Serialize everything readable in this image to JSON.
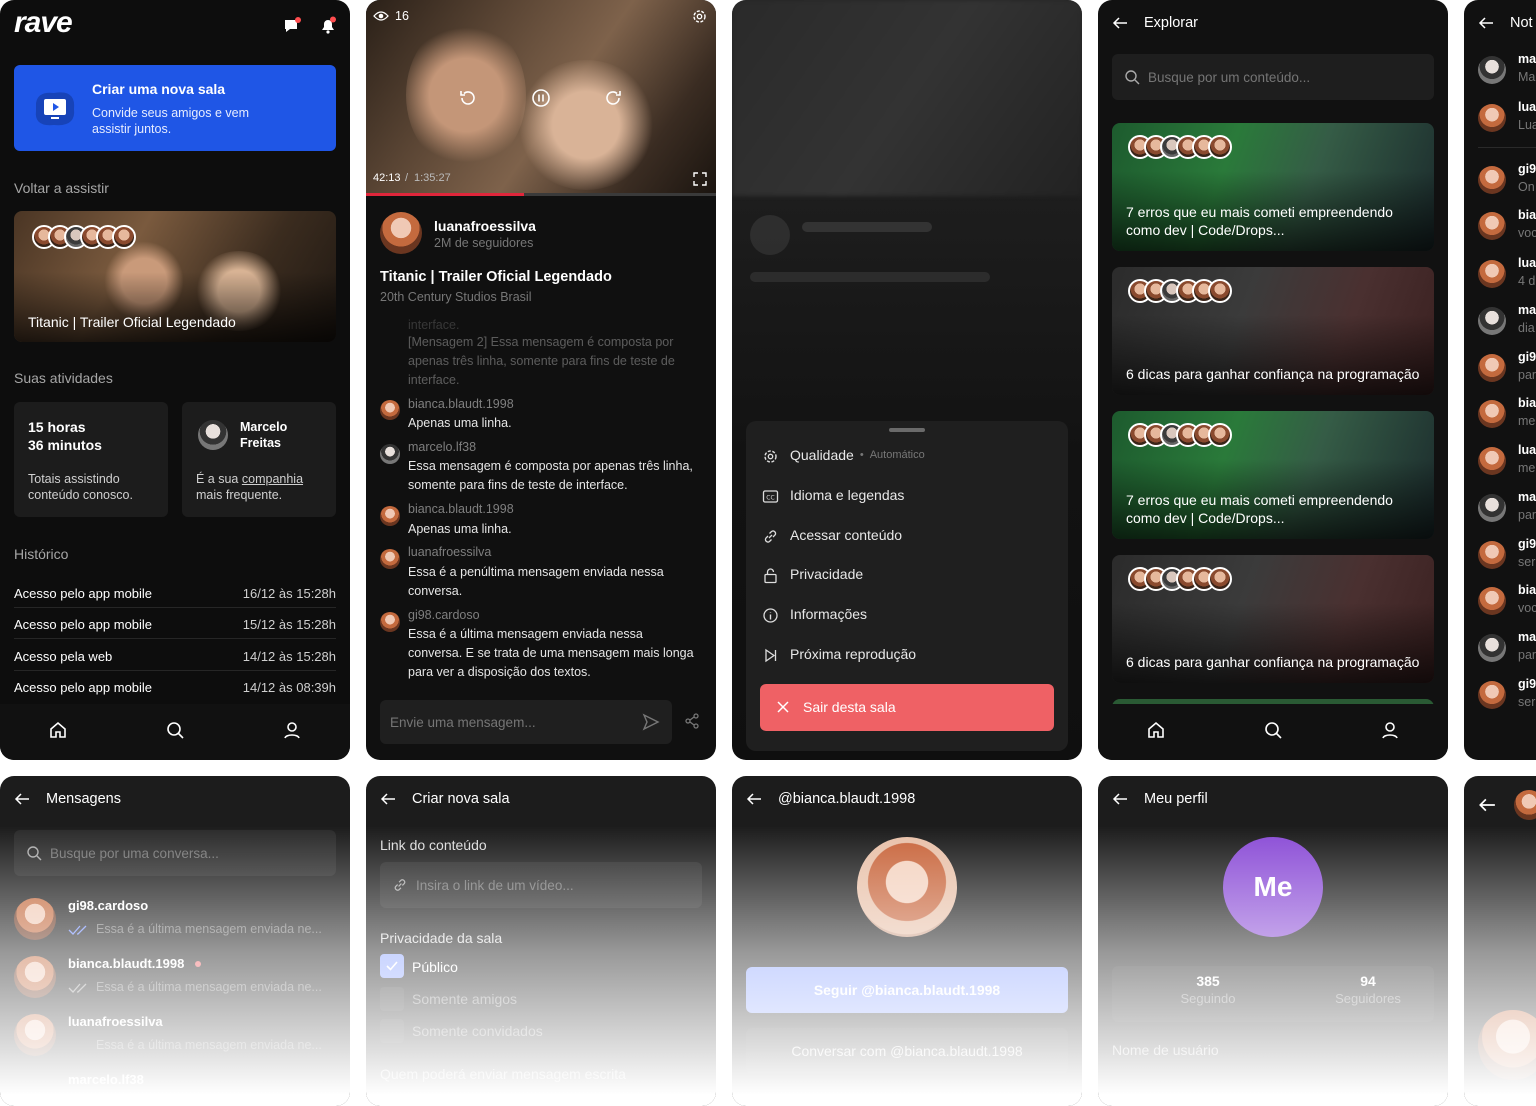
{
  "home": {
    "logo": "rave",
    "create_title": "Criar uma nova sala",
    "create_sub": "Convide seus amigos e vem assistir juntos.",
    "continue_label": "Voltar a assistir",
    "continue_video": "Titanic | Trailer Oficial Legendado",
    "activities_label": "Suas atividades",
    "hours": "15 horas\n36 minutos",
    "hours_desc": "Totais assistindo conteúdo conosco.",
    "friend_name": "Marcelo\nFreitas",
    "friend_desc_a": "É a sua ",
    "friend_desc_link": "companhia",
    "friend_desc_b": "mais frequente.",
    "history_label": "Histórico",
    "history": [
      {
        "label": "Acesso pelo app mobile",
        "date": "16/12 às 15:28h"
      },
      {
        "label": "Acesso pelo app mobile",
        "date": "15/12 às 15:28h"
      },
      {
        "label": "Acesso pela web",
        "date": "14/12 às 15:28h"
      },
      {
        "label": "Acesso pelo app mobile",
        "date": "14/12 às 08:39h"
      }
    ]
  },
  "player": {
    "views": "16",
    "time": "42:13",
    "duration": "1:35:27",
    "progress": 0.45,
    "channel": "luanafroessilva",
    "followers": "2M de seguidores",
    "title": "Titanic | Trailer Oficial Legendado",
    "studio": "20th Century Studios Brasil",
    "messages": [
      {
        "user": "interface.",
        "text": "[Mensagem 2] Essa mensagem é composta por apenas três linha, somente para fins de teste de interface.",
        "faded": true
      },
      {
        "user": "bianca.blaudt.1998",
        "text": "Apenas uma linha."
      },
      {
        "user": "marcelo.lf38",
        "text": "Essa mensagem é composta por apenas três linha, somente para fins de teste de interface."
      },
      {
        "user": "bianca.blaudt.1998",
        "text": "Apenas uma linha."
      },
      {
        "user": "luanafroessilva",
        "text": "Essa é a penúltima mensagem enviada nessa conversa."
      },
      {
        "user": "gi98.cardoso",
        "text": "Essa é a última mensagem enviada nessa conversa. E se trata de uma mensagem mais longa para ver a disposição dos textos."
      }
    ],
    "input_placeholder": "Envie uma mensagem..."
  },
  "settings": {
    "items": [
      {
        "label": "Qualidade",
        "extra": "Automático",
        "icon": "gear-icon"
      },
      {
        "label": "Idioma e legendas",
        "icon": "cc-icon"
      },
      {
        "label": "Acessar conteúdo",
        "icon": "link-icon"
      },
      {
        "label": "Privacidade",
        "icon": "lock-icon"
      },
      {
        "label": "Informações",
        "icon": "info-icon"
      },
      {
        "label": "Próxima reprodução",
        "icon": "skip-next-icon"
      }
    ],
    "leave": "Sair desta sala",
    "leave_color": "#ef6165"
  },
  "explore": {
    "title": "Explorar",
    "search_placeholder": "Busque por um conteúdo...",
    "cards": [
      "7 erros que eu mais cometi empreendendo como dev | Code/Drops...",
      "6 dicas para ganhar confiança na programação",
      "7 erros que eu mais cometi empreendendo como dev | Code/Drops...",
      "6 dicas para ganhar confiança na programação"
    ]
  },
  "notifications": {
    "title": "Not",
    "items": [
      {
        "u": "ma",
        "s": "Ma"
      },
      {
        "u": "lua",
        "s": "Lua"
      },
      {
        "u": "gi9",
        "s": "On"
      },
      {
        "u": "bia",
        "s": "voc"
      },
      {
        "u": "lua",
        "s": "4 d"
      },
      {
        "u": "ma",
        "s": "dia"
      },
      {
        "u": "gi9",
        "s": "par"
      },
      {
        "u": "bia",
        "s": "me"
      },
      {
        "u": "lua",
        "s": "me"
      },
      {
        "u": "ma",
        "s": "par"
      },
      {
        "u": "gi9",
        "s": "ser"
      },
      {
        "u": "bia",
        "s": "voc"
      },
      {
        "u": "ma",
        "s": "par"
      },
      {
        "u": "gi9",
        "s": "ser"
      }
    ]
  },
  "messages": {
    "title": "Mensagens",
    "search_placeholder": "Busque por uma conversa...",
    "convos": [
      {
        "name": "gi98.cardoso",
        "last": "Essa é a última mensagem enviada ne..."
      },
      {
        "name": "bianca.blaudt.1998",
        "last": "Essa é a última mensagem enviada ne..."
      },
      {
        "name": "luanafroessilva",
        "last": "Essa é a última mensagem enviada ne..."
      },
      {
        "name": "marcelo.lf38",
        "last": ""
      }
    ]
  },
  "create_room": {
    "title": "Criar nova sala",
    "link_label": "Link do conteúdo",
    "link_placeholder": "Insira o link de um vídeo...",
    "privacy_label": "Privacidade da sala",
    "opt_public": "Público",
    "opt_friends": "Somente amigos",
    "opt_invited": "Somente convidados",
    "who_label": "Quem poderá enviar mensagem escrita"
  },
  "profile_other": {
    "title": "@bianca.blaudt.1998",
    "follow": "Seguir @bianca.blaudt.1998",
    "chat": "Conversar com @bianca.blaudt.1998"
  },
  "my_profile": {
    "title": "Meu perfil",
    "avatar_text": "Me",
    "following": "385",
    "following_label": "Seguindo",
    "followers": "94",
    "followers_label": "Seguidores",
    "username_label": "Nome de usuário"
  }
}
